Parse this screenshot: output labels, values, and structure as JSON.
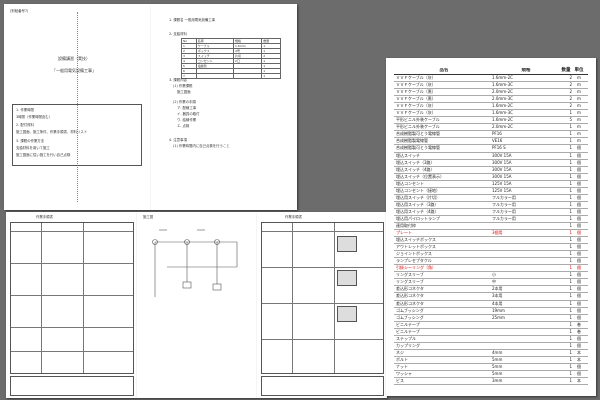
{
  "pageA": {
    "header_tag": "(別紙番号7)",
    "title_line1": "設備講習（実技）",
    "title_line2": "「一般用電気設備工事」",
    "box_lines": [
      "1. 作業時間",
      "  3時間（作業時間含む）",
      "2. 配付資料",
      "  施工図面、施工条件、作業手順書、材料リスト",
      "3. 課題の作業方法",
      "  支給材料を用いて施工",
      "  施工図面に従い施工を行い自己点検"
    ]
  },
  "pageB": {
    "lines": [
      "1. 課題名   一般用電気設備工事",
      "2. 支給材料",
      "3. 課題内容",
      "(1) 作業課題",
      "  施工図面",
      "(2) 作業の手順",
      "  ア. 配線工事",
      "  イ. 器具の取付",
      "  ウ. 結線作業",
      "  エ. 点検",
      "4. 注意事項",
      "(1) 作業時間内に自己点検を行うこと"
    ],
    "table_header": [
      "No",
      "名称",
      "規格",
      "数量"
    ],
    "table_rows": [
      [
        "1",
        "ケーブル",
        "1.6mm",
        "1"
      ],
      [
        "2",
        "ボックス",
        "4号",
        "1"
      ],
      [
        "3",
        "スイッチ",
        "片切",
        "2"
      ],
      [
        "4",
        "コンセント",
        "2口",
        "1"
      ],
      [
        "5",
        "電線管",
        "",
        "1"
      ],
      [
        "6",
        "",
        "",
        "1"
      ],
      [
        "7",
        "",
        "",
        "1"
      ]
    ]
  },
  "pageC": {
    "header": "作業手順書"
  },
  "pageD": {
    "header": "施工図"
  },
  "pageE": {
    "header": "作業手順書"
  },
  "list": {
    "headers": [
      "品名",
      "規格",
      "数量",
      "単位"
    ],
    "rows": [
      {
        "name": "ＶＶＦケーブル（灰）",
        "spec": "1.6mm-2C",
        "qty": "2",
        "unit": "m",
        "red": false
      },
      {
        "name": "ＶＶＦケーブル（灰）",
        "spec": "1.6mm-3C",
        "qty": "2",
        "unit": "m",
        "red": false
      },
      {
        "name": "ＶＶＦケーブル（黒）",
        "spec": "2.0mm-2C",
        "qty": "2",
        "unit": "m",
        "red": false
      },
      {
        "name": "ＶＶＦケーブル（黒）",
        "spec": "2.0mm-3C",
        "qty": "2",
        "unit": "m",
        "red": false
      },
      {
        "name": "ＶＶＦケーブル（灰）",
        "spec": "1.6mm-2C",
        "qty": "2",
        "unit": "m",
        "red": false
      },
      {
        "name": "ＶＶＦケーブル（灰）",
        "spec": "1.6mm-3C",
        "qty": "1",
        "unit": "m",
        "red": false
      },
      {
        "name": "平形ビニル外装ケーブル",
        "spec": "1.6mm-2C",
        "qty": "5",
        "unit": "m",
        "red": false
      },
      {
        "name": "平形ビニル外装ケーブル",
        "spec": "2.0mm-2C",
        "qty": "1",
        "unit": "m",
        "red": false
      },
      {
        "name": "合成樹脂製可とう電線管",
        "spec": "PF16",
        "qty": "1",
        "unit": "m",
        "red": false
      },
      {
        "name": "合成樹脂製電線管",
        "spec": "VE16",
        "qty": "1",
        "unit": "m",
        "red": false
      },
      {
        "name": "合成樹脂製可とう電線管",
        "spec": "PF16 S",
        "qty": "1",
        "unit": "個",
        "red": false
      },
      {
        "name": "埋込スイッチ",
        "spec": "300V 15A",
        "qty": "1",
        "unit": "個",
        "red": false
      },
      {
        "name": "埋込スイッチ（3路）",
        "spec": "300V 15A",
        "qty": "1",
        "unit": "個",
        "red": false
      },
      {
        "name": "埋込スイッチ（4路）",
        "spec": "300V 15A",
        "qty": "1",
        "unit": "個",
        "red": false
      },
      {
        "name": "埋込スイッチ（位置表示）",
        "spec": "300V 15A",
        "qty": "1",
        "unit": "個",
        "red": false
      },
      {
        "name": "埋込コンセント",
        "spec": "125V 15A",
        "qty": "1",
        "unit": "個",
        "red": false
      },
      {
        "name": "埋込コンセント（接地）",
        "spec": "125V 15A",
        "qty": "1",
        "unit": "個",
        "red": false
      },
      {
        "name": "埋込用スイッチ（片切）",
        "spec": "フルカラー用",
        "qty": "1",
        "unit": "個",
        "red": false
      },
      {
        "name": "埋込用スイッチ（3路）",
        "spec": "フルカラー用",
        "qty": "1",
        "unit": "個",
        "red": false
      },
      {
        "name": "埋込用スイッチ（4路）",
        "spec": "フルカラー用",
        "qty": "1",
        "unit": "個",
        "red": false
      },
      {
        "name": "埋込用パイロットランプ",
        "spec": "フルカラー用",
        "qty": "1",
        "unit": "個",
        "red": false
      },
      {
        "name": "連用取付枠",
        "spec": "",
        "qty": "1",
        "unit": "個",
        "red": false
      },
      {
        "name": "プレート",
        "spec": "3個用",
        "qty": "1",
        "unit": "個",
        "red": true
      },
      {
        "name": "埋込スイッチボックス",
        "spec": "",
        "qty": "1",
        "unit": "個",
        "red": false
      },
      {
        "name": "アウトレットボックス",
        "spec": "",
        "qty": "1",
        "unit": "個",
        "red": false
      },
      {
        "name": "ジョイントボックス",
        "spec": "",
        "qty": "1",
        "unit": "個",
        "red": false
      },
      {
        "name": "ランプレセプタクル",
        "spec": "",
        "qty": "1",
        "unit": "個",
        "red": false
      },
      {
        "name": "引掛シーリング（角）",
        "spec": "",
        "qty": "1",
        "unit": "個",
        "red": true
      },
      {
        "name": "リングスリーブ",
        "spec": "小",
        "qty": "1",
        "unit": "個",
        "red": false
      },
      {
        "name": "リングスリーブ",
        "spec": "中",
        "qty": "1",
        "unit": "個",
        "red": false
      },
      {
        "name": "差込形コネクタ",
        "spec": "2本用",
        "qty": "1",
        "unit": "個",
        "red": false
      },
      {
        "name": "差込形コネクタ",
        "spec": "3本用",
        "qty": "1",
        "unit": "個",
        "red": false
      },
      {
        "name": "差込形コネクタ",
        "spec": "4本用",
        "qty": "1",
        "unit": "個",
        "red": false
      },
      {
        "name": "ゴムブッシング",
        "spec": "19mm",
        "qty": "1",
        "unit": "個",
        "red": false
      },
      {
        "name": "ゴムブッシング",
        "spec": "25mm",
        "qty": "1",
        "unit": "個",
        "red": false
      },
      {
        "name": "ビニルテープ",
        "spec": "",
        "qty": "1",
        "unit": "巻",
        "red": false
      },
      {
        "name": "ビニルテープ",
        "spec": "",
        "qty": "1",
        "unit": "巻",
        "red": false
      },
      {
        "name": "ステップル",
        "spec": "",
        "qty": "1",
        "unit": "個",
        "red": false
      },
      {
        "name": "カップリング",
        "spec": "",
        "qty": "1",
        "unit": "個",
        "red": false
      },
      {
        "name": "ネジ",
        "spec": "4mm",
        "qty": "1",
        "unit": "本",
        "red": false
      },
      {
        "name": "ボルト",
        "spec": "5mm",
        "qty": "1",
        "unit": "本",
        "red": false
      },
      {
        "name": "ナット",
        "spec": "5mm",
        "qty": "1",
        "unit": "個",
        "red": false
      },
      {
        "name": "ワッシャ",
        "spec": "5mm",
        "qty": "1",
        "unit": "個",
        "red": false
      },
      {
        "name": "ビス",
        "spec": "3mm",
        "qty": "1",
        "unit": "本",
        "red": false
      }
    ]
  }
}
